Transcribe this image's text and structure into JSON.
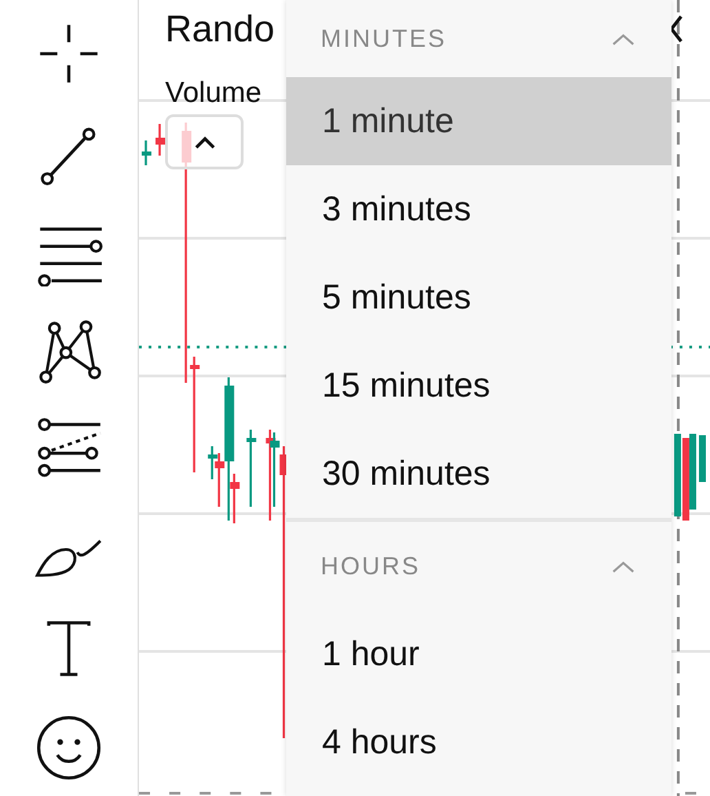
{
  "toolbar": [
    {
      "kind": "crosshair"
    },
    {
      "kind": "trend-line"
    },
    {
      "kind": "parallel-lines"
    },
    {
      "kind": "pattern"
    },
    {
      "kind": "fib"
    },
    {
      "kind": "brush"
    },
    {
      "kind": "text"
    },
    {
      "kind": "emoji"
    }
  ],
  "chart": {
    "title": "Rando",
    "subtitle": "Volume",
    "collapse_expanded": true
  },
  "menu": {
    "sections": [
      {
        "label": "MINUTES",
        "expanded": true,
        "items": [
          {
            "label": "1 minute",
            "selected": true
          },
          {
            "label": "3 minutes",
            "selected": false
          },
          {
            "label": "5 minutes",
            "selected": false
          },
          {
            "label": "15 minutes",
            "selected": false
          },
          {
            "label": "30 minutes",
            "selected": false
          }
        ]
      },
      {
        "label": "HOURS",
        "expanded": true,
        "items": [
          {
            "label": "1 hour",
            "selected": false
          },
          {
            "label": "4 hours",
            "selected": false
          }
        ]
      }
    ]
  }
}
